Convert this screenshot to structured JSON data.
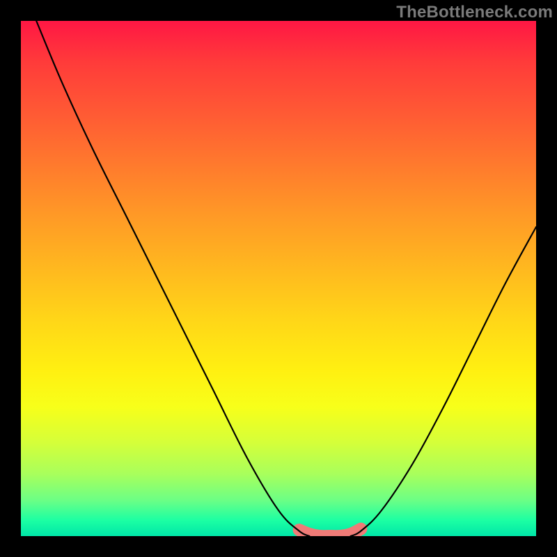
{
  "watermark": "TheBottleneck.com",
  "chart_data": {
    "type": "line",
    "title": "",
    "xlabel": "",
    "ylabel": "",
    "xlim": [
      0,
      100
    ],
    "ylim": [
      0,
      100
    ],
    "series": [
      {
        "name": "left-curve",
        "x": [
          3,
          8,
          14,
          21,
          29,
          37,
          44,
          50,
          54,
          56
        ],
        "y": [
          100,
          88,
          75,
          61,
          45,
          29,
          15,
          5,
          1,
          0
        ]
      },
      {
        "name": "right-curve",
        "x": [
          64,
          66,
          70,
          76,
          82,
          88,
          94,
          100
        ],
        "y": [
          0,
          1,
          5,
          14,
          25,
          37,
          49,
          60
        ]
      },
      {
        "name": "bottom-highlight",
        "x": [
          54,
          56,
          58,
          60,
          62,
          64,
          66
        ],
        "y": [
          1.2,
          0.4,
          0,
          0,
          0,
          0.4,
          1.4
        ]
      }
    ],
    "colors": {
      "curve": "#000000",
      "highlight": "#ef7b77"
    },
    "gradient_stops": [
      {
        "pos": 0.0,
        "color": "#ff1744"
      },
      {
        "pos": 0.5,
        "color": "#ffd618"
      },
      {
        "pos": 0.75,
        "color": "#f7ff1a"
      },
      {
        "pos": 1.0,
        "color": "#00e6a8"
      }
    ]
  }
}
